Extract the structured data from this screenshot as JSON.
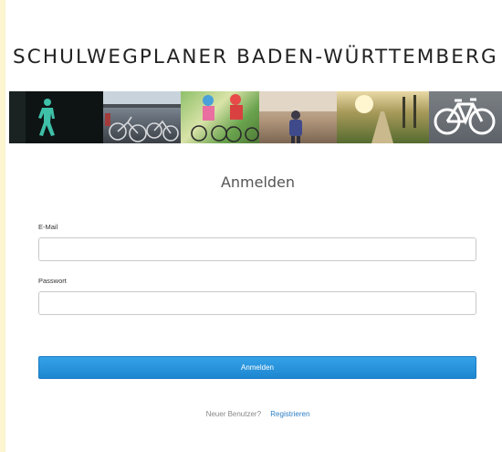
{
  "site": {
    "title": "SCHULWEGPLANER BADEN-WÜRTTEMBERG"
  },
  "banner": {
    "images": [
      "green-pedestrian-traffic-light",
      "parked-bicycles",
      "children-on-bicycles",
      "child-walking-on-path",
      "sunlit-road",
      "bicycle-lane-sign"
    ]
  },
  "login": {
    "heading": "Anmelden",
    "email_label": "E-Mail",
    "email_value": "",
    "email_placeholder": "",
    "password_label": "Passwort",
    "password_value": "",
    "password_placeholder": "",
    "submit_label": "Anmelden"
  },
  "register": {
    "prompt": "Neuer Benutzer?",
    "link_label": "Registrieren"
  },
  "colors": {
    "accent": "#1d86d0",
    "link": "#2a7dc4",
    "left_edge": "#fbf6cf"
  }
}
